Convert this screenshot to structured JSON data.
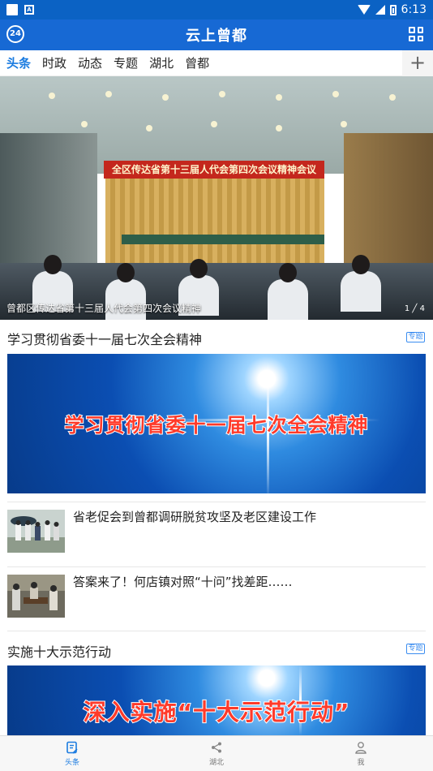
{
  "statusbar": {
    "time": "6:13"
  },
  "appbar": {
    "logo_text": "24",
    "title": "云上曾都"
  },
  "tabs": [
    {
      "label": "头条",
      "active": true
    },
    {
      "label": "时政"
    },
    {
      "label": "动态"
    },
    {
      "label": "专题"
    },
    {
      "label": "湖北"
    },
    {
      "label": "曾都"
    }
  ],
  "tab_add_symbol": "+",
  "hero": {
    "banner_text": "全区传达省第十三届人代会第四次会议精神会议",
    "caption": "曾都区传达省第十三届人代会第四次会议精神",
    "pager": "1 ╱ 4"
  },
  "topics": [
    {
      "title": "学习贯彻省委十一届七次全会精神",
      "badge": "专题",
      "banner_text": "学习贯彻省委十一届七次全会精神"
    },
    {
      "title": "实施十大示范行动",
      "badge": "专题",
      "banner_text": "深入实施“十大示范行动”"
    }
  ],
  "news": [
    {
      "title": "省老促会到曾都调研脱贫攻坚及老区建设工作"
    },
    {
      "title": "答案来了！何店镇对照“十问”找差距……"
    }
  ],
  "bottom_nav": [
    {
      "label": "头条",
      "icon": "news-icon",
      "active": true
    },
    {
      "label": "湖北",
      "icon": "share-icon"
    },
    {
      "label": "我",
      "icon": "user-icon"
    }
  ]
}
